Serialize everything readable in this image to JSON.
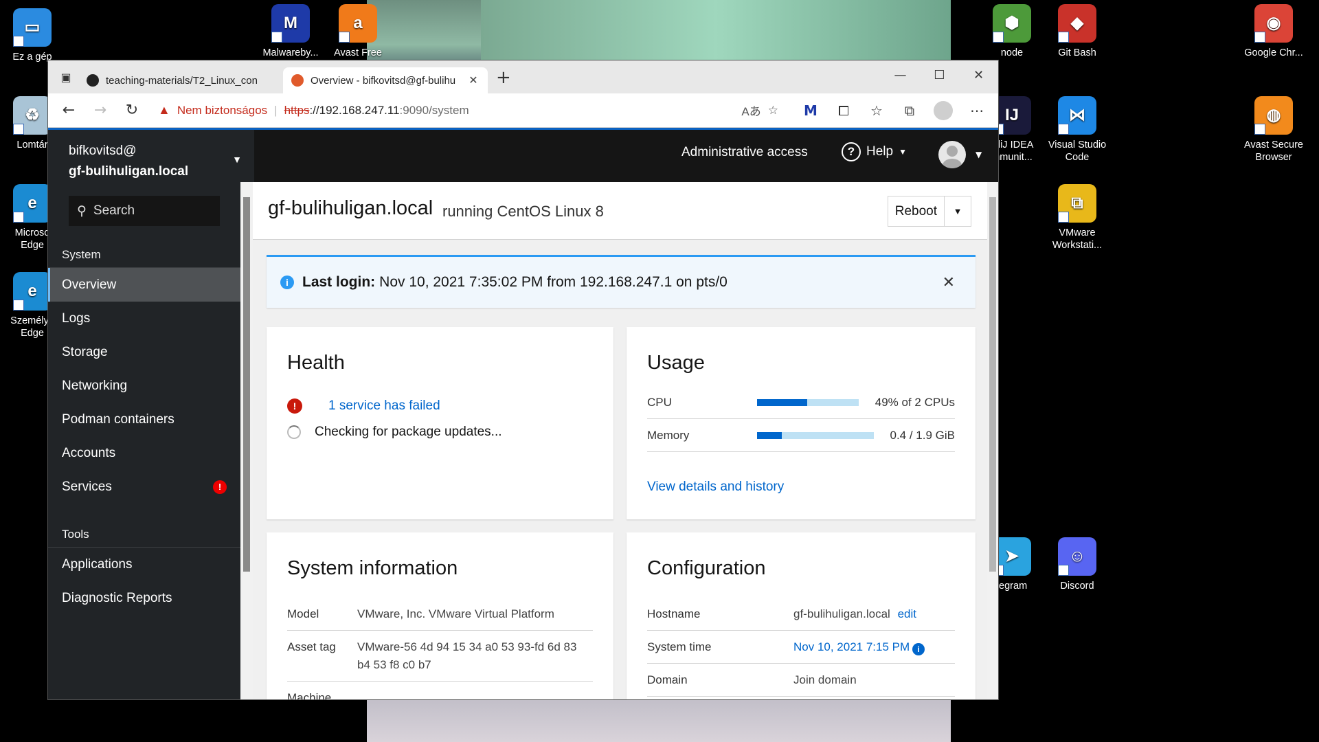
{
  "desktop": {
    "icons": [
      {
        "label": "Ez a gép",
        "color": "#2b8be0",
        "glyph": "▭"
      },
      {
        "label": "Lomtár",
        "color": "#a9c4d6",
        "glyph": "♻"
      },
      {
        "label": "Microso\nEdge",
        "color": "#1b8bd2",
        "glyph": "e"
      },
      {
        "label": "Személye\nEdge",
        "color": "#1b8bd2",
        "glyph": "e"
      },
      {
        "label": "Malwareby...",
        "color": "#1e3aa8",
        "glyph": "M"
      },
      {
        "label": "Avast Free",
        "color": "#f07a1a",
        "glyph": "a"
      },
      {
        "label": "node",
        "color": "#4d9a3a",
        "glyph": "⬢"
      },
      {
        "label": "Git Bash",
        "color": "#c9322a",
        "glyph": "◆"
      },
      {
        "label": "Google Chr...",
        "color": "#db4437",
        "glyph": "◉"
      },
      {
        "label": "elliJ IDEA\nmmunit...",
        "color": "#1a1a3a",
        "glyph": "IJ"
      },
      {
        "label": "Visual Studio\nCode",
        "color": "#1e88e5",
        "glyph": "⋈"
      },
      {
        "label": "Avast Secure\nBrowser",
        "color": "#f28a1c",
        "glyph": "◍"
      },
      {
        "label": "VMware\nWorkstati...",
        "color": "#e8b81a",
        "glyph": "⧉"
      },
      {
        "label": "legram",
        "color": "#2aa3df",
        "glyph": "➤"
      },
      {
        "label": "Discord",
        "color": "#5865f2",
        "glyph": "☺"
      }
    ]
  },
  "browser": {
    "tabs": [
      {
        "title": "teaching-materials/T2_Linux_con",
        "favicon_color": "#222222"
      },
      {
        "title": "Overview - bifkovitsd@gf-bulihu",
        "favicon_color": "#e05a2b"
      }
    ],
    "new_tab": "+",
    "window_controls": [
      "—",
      "☐",
      "✕"
    ],
    "address": {
      "warning": "Nem biztonságos",
      "proto": "https",
      "host": "://192.168.247.11",
      "path": ":9090/system"
    }
  },
  "cockpit": {
    "host_user": "bifkovitsd@",
    "host_name": "gf-bulihuligan.local",
    "admin_access": "Administrative access",
    "help": "Help",
    "search_placeholder": "Search",
    "nav": {
      "system_header": "System",
      "items": [
        "Overview",
        "Logs",
        "Storage",
        "Networking",
        "Podman containers",
        "Accounts",
        "Services"
      ],
      "tools_header": "Tools",
      "tools_items": [
        "Applications",
        "Diagnostic Reports"
      ]
    },
    "page": {
      "title": "gf-bulihuligan.local",
      "subtitle": "running CentOS Linux 8",
      "reboot": "Reboot"
    },
    "alert": {
      "label": "Last login:",
      "text": "Nov 10, 2021 7:35:02 PM from 192.168.247.1 on pts/0"
    },
    "health": {
      "title": "Health",
      "failed": "1 service has failed",
      "checking": "Checking for package updates..."
    },
    "usage": {
      "title": "Usage",
      "cpu_label": "CPU",
      "cpu_value": "49% of 2 CPUs",
      "cpu_fraction": 0.49,
      "mem_label": "Memory",
      "mem_value": "0.4 / 1.9 GiB",
      "mem_fraction": 0.21,
      "details_link": "View details and history"
    },
    "sysinfo": {
      "title": "System information",
      "model_label": "Model",
      "model_value": "VMware, Inc. VMware Virtual Platform",
      "asset_label": "Asset tag",
      "asset_value": "VMware-56 4d 94 15 34 a0 53 93-fd 6d 83 b4 53 f8 c0 b7",
      "machine_label": "Machine"
    },
    "config": {
      "title": "Configuration",
      "hostname_label": "Hostname",
      "hostname_value": "gf-bulihuligan.local",
      "hostname_edit": "edit",
      "time_label": "System time",
      "time_value": "Nov 10, 2021 7:15 PM",
      "domain_label": "Domain",
      "domain_value": "Join domain"
    }
  }
}
